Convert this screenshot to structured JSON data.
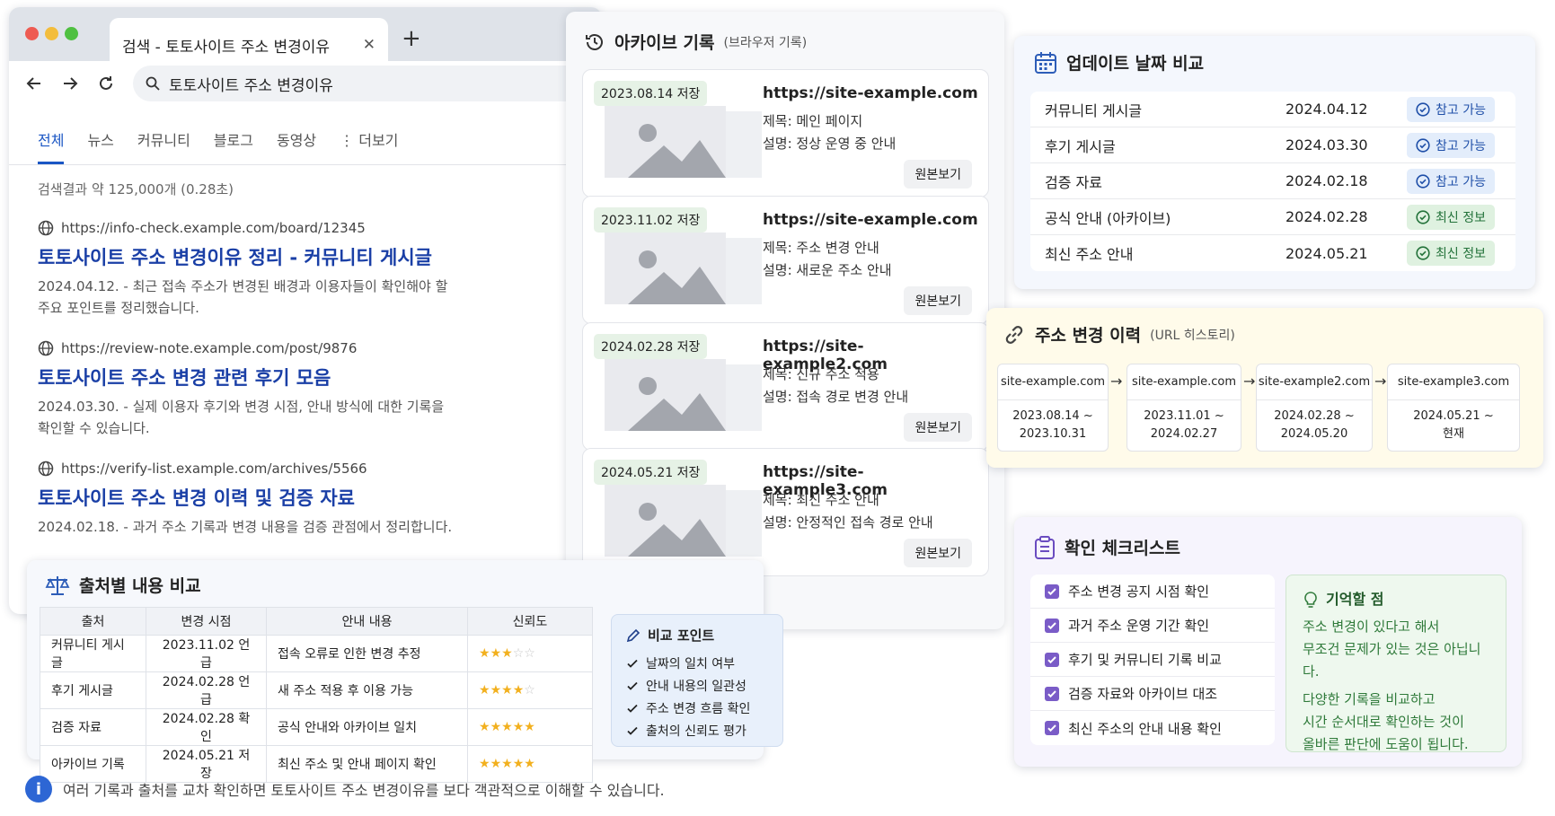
{
  "browser": {
    "tab_title": "검색 - 토토사이트 주소 변경이유",
    "close_glyph": "✕",
    "new_tab_glyph": "+",
    "search_query": "토토사이트 주소 변경이유",
    "nav_tabs": [
      "전체",
      "뉴스",
      "커뮤니티",
      "블로그",
      "동영상",
      "⋮ 더보기"
    ],
    "result_count": "검색결과 약 125,000개 (0.28초)",
    "results": [
      {
        "url": "https://info-check.example.com/board/12345",
        "title": "토토사이트 주소 변경이유 정리 - 커뮤니티 게시글",
        "desc": "2024.04.12. - 최근 접속 주소가 변경된 배경과 이용자들이 확인해야 할 주요 포인트를 정리했습니다."
      },
      {
        "url": "https://review-note.example.com/post/9876",
        "title": "토토사이트 주소 변경 관련 후기 모음",
        "desc": "2024.03.30. - 실제 이용자 후기와 변경 시점, 안내 방식에 대한 기록을 확인할 수 있습니다."
      },
      {
        "url": "https://verify-list.example.com/archives/5566",
        "title": "토토사이트 주소 변경 이력 및 검증 자료",
        "desc": "2024.02.18. - 과거 주소 기록과 변경 내용을 검증 관점에서 정리합니다."
      }
    ]
  },
  "archive": {
    "title": "아카이브 기록",
    "subtitle": "(브라우저 기록)",
    "cards": [
      {
        "date": "2023.08.14 저장",
        "site": "https://site-example.com",
        "title_line": "제목:  메인 페이지",
        "desc_line": "설명:  정상 운영 중 안내",
        "button": "원본보기"
      },
      {
        "date": "2023.11.02 저장",
        "site": "https://site-example.com",
        "title_line": "제목:  주소 변경 안내",
        "desc_line": "설명:  새로운 주소 안내",
        "button": "원본보기"
      },
      {
        "date": "2024.02.28 저장",
        "site": "https://site-example2.com",
        "title_line": "제목:  신규 주소 적용",
        "desc_line": "설명:  접속 경로 변경 안내",
        "button": "원본보기"
      },
      {
        "date": "2024.05.21 저장",
        "site": "https://site-example3.com",
        "title_line": "제목:  최신 주소 안내",
        "desc_line": "설명:  안정적인 접속 경로 안내",
        "button": "원본보기"
      }
    ],
    "arrow_glyph": "↓"
  },
  "update": {
    "title": "업데이트 날짜 비교",
    "rows": [
      {
        "name": "커뮤니티 게시글",
        "date": "2024.04.12",
        "status": "참고 가능",
        "kind": "ref"
      },
      {
        "name": "후기 게시글",
        "date": "2024.03.30",
        "status": "참고 가능",
        "kind": "ref"
      },
      {
        "name": "검증 자료",
        "date": "2024.02.18",
        "status": "참고 가능",
        "kind": "ref"
      },
      {
        "name": "공식 안내 (아카이브)",
        "date": "2024.02.28",
        "status": "최신 정보",
        "kind": "new"
      },
      {
        "name": "최신 주소 안내",
        "date": "2024.05.21",
        "status": "최신 정보",
        "kind": "new"
      }
    ],
    "colors": {
      "ref_bg": "#e3edfb",
      "ref_fg": "#1f4fa8",
      "new_bg": "#dff1e0",
      "new_fg": "#23723a"
    }
  },
  "url_history": {
    "title": "주소 변경 이력",
    "subtitle": "(URL 히스토리)",
    "items": [
      {
        "site": "site-example.com",
        "period_start": "2023.08.14 ~",
        "period_end": "2023.10.31"
      },
      {
        "site": "site-example.com",
        "period_start": "2023.11.01 ~",
        "period_end": "2024.02.27"
      },
      {
        "site": "site-example2.com",
        "period_start": "2024.02.28 ~",
        "period_end": "2024.05.20"
      },
      {
        "site": "site-example3.com",
        "period_start": "2024.05.21 ~",
        "period_end": "현재"
      }
    ],
    "arrow_glyph": "→"
  },
  "checklist": {
    "title": "확인 체크리스트",
    "items": [
      "주소 변경 공지 시점 확인",
      "과거 주소 운영 기간 확인",
      "후기 및 커뮤니티 기록 비교",
      "검증 자료와 아카이브 대조",
      "최신 주소의 안내 내용 확인"
    ],
    "memo_title": "기억할 점",
    "memo_lines": [
      "주소 변경이 있다고 해서",
      "무조건 문제가 있는 것은 아닙니다.",
      "다양한 기록을 비교하고",
      "시간 순서대로 확인하는 것이",
      "올바른 판단에 도움이 됩니다."
    ]
  },
  "source": {
    "title": "출처별 내용 비교",
    "headers": [
      "출처",
      "변경 시점",
      "안내 내용",
      "신뢰도"
    ],
    "rows": [
      {
        "src": "커뮤니티 게시글",
        "when": "2023.11.02 언급",
        "content": "접속 오류로 인한 변경 추정",
        "stars": 3
      },
      {
        "src": "후기 게시글",
        "when": "2024.02.28 언급",
        "content": "새 주소 적용 후 이용 가능",
        "stars": 4
      },
      {
        "src": "검증 자료",
        "when": "2024.02.28 확인",
        "content": "공식 안내와 아카이브 일치",
        "stars": 5
      },
      {
        "src": "아카이브 기록",
        "when": "2024.05.21 저장",
        "content": "최신 주소 및 안내 페이지 확인",
        "stars": 5
      }
    ],
    "point_title": "비교 포인트",
    "points": [
      "날짜의 일치 여부",
      "안내 내용의 일관성",
      "주소 변경 흐름 확인",
      "출처의 신뢰도 평가"
    ]
  },
  "footer": {
    "info_glyph": "i",
    "text": "여러 기록과 출처를 교차 확인하면 토토사이트 주소 변경이유를 보다 객관적으로 이해할 수 있습니다."
  }
}
